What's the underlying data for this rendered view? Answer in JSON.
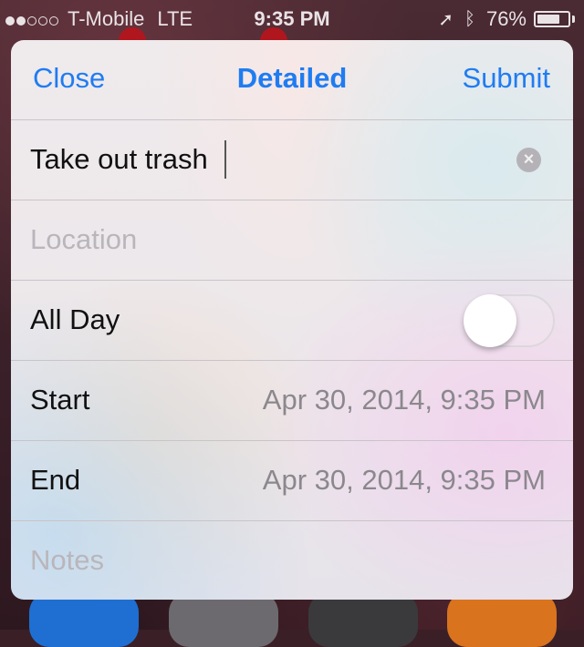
{
  "status_bar": {
    "carrier": "T-Mobile",
    "network": "LTE",
    "time": "9:35 PM",
    "battery_percent_text": "76%",
    "battery_level": 0.76,
    "signal_bars_filled": 2,
    "signal_bars_total": 5,
    "icons": [
      "location-arrow-icon",
      "bluetooth-icon",
      "battery-icon"
    ]
  },
  "nav": {
    "close_label": "Close",
    "title": "Detailed",
    "submit_label": "Submit"
  },
  "form": {
    "title_value": "Take out trash",
    "location_placeholder": "Location",
    "all_day_label": "All Day",
    "all_day_on": false,
    "start_label": "Start",
    "start_value": "Apr 30, 2014, 9:35 PM",
    "end_label": "End",
    "end_value": "Apr 30, 2014, 9:35 PM",
    "notes_placeholder": "Notes"
  },
  "colors": {
    "accent": "#1f7cf2",
    "separator": "#c9c4c8",
    "placeholder": "#b9b6bb",
    "value_text": "#8b888d"
  }
}
